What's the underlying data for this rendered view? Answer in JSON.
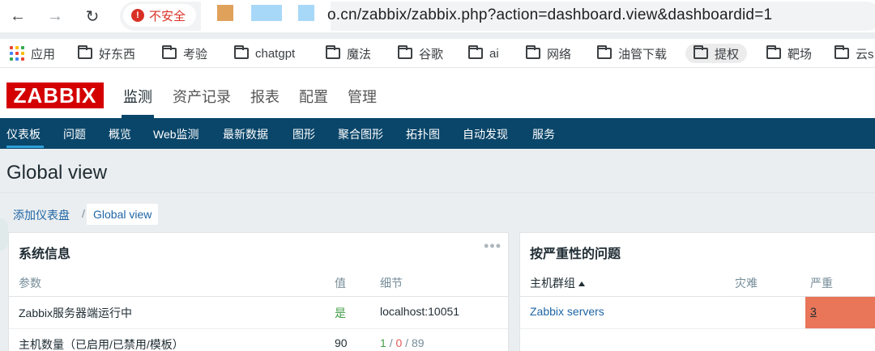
{
  "browser": {
    "security_label": "不安全",
    "url": "o.cn/zabbix/zabbix.php?action=dashboard.view&dashboardid=1",
    "bookmarks": [
      "应用",
      "好东西",
      "考验",
      "chatgpt",
      "魔法",
      "谷歌",
      "ai",
      "网络",
      "油管下载",
      "提权",
      "靶场",
      "云s"
    ],
    "redaction_colors": [
      "#e0a15b",
      "#a8d8f8",
      "#a8d8f8"
    ]
  },
  "header": {
    "logo": "ZABBIX",
    "menu": [
      "监测",
      "资产记录",
      "报表",
      "配置",
      "管理"
    ]
  },
  "submenu": [
    "仪表板",
    "问题",
    "概览",
    "Web监测",
    "最新数据",
    "图形",
    "聚合图形",
    "拓扑图",
    "自动发现",
    "服务"
  ],
  "page": {
    "title": "Global view",
    "breadcrumb": {
      "parent": "添加仪表盘",
      "separator": "/",
      "current": "Global view"
    }
  },
  "system_info": {
    "title": "系统信息",
    "menu_icon": "•••",
    "columns": [
      "参数",
      "值",
      "细节"
    ],
    "rows": [
      {
        "param": "Zabbix服务器端运行中",
        "value": "是",
        "detail": "localhost:10051"
      },
      {
        "param": "主机数量（已启用/已禁用/模板）",
        "value": "90",
        "detail_enabled": "1",
        "detail_sep": "/",
        "detail_disabled": "0",
        "detail_templates": "89"
      }
    ]
  },
  "problems_by_severity": {
    "title": "按严重性的问题",
    "columns": [
      "主机群组",
      "灾难",
      "严重"
    ],
    "rows": [
      {
        "group": "Zabbix servers",
        "disaster": "",
        "high": "3"
      }
    ]
  },
  "colors": {
    "brand": "#d40000",
    "nav": "#0a466a",
    "link": "#1f65a5",
    "high_severity": "#e97659",
    "ok": "#429e47",
    "problem": "#e45959"
  }
}
